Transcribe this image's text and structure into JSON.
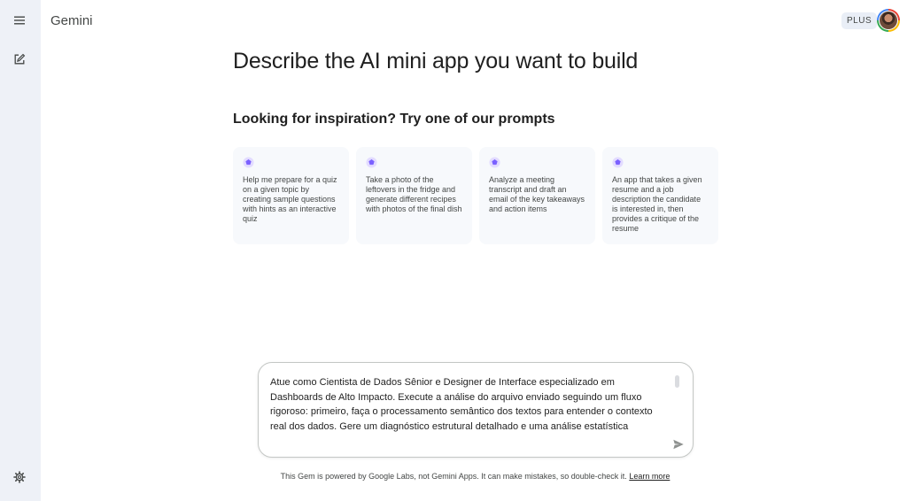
{
  "header": {
    "app_title": "Gemini",
    "plan_badge": "PLUS"
  },
  "icons": {
    "menu": "hamburger-menu-icon",
    "new_chat": "edit-square-icon",
    "settings": "gear-icon",
    "gem": "gem-icon",
    "send": "send-icon"
  },
  "colors": {
    "rail_bg": "#eef1f7",
    "card_bg": "#f7f9fc",
    "gem_accent": "#7b61ff"
  },
  "main": {
    "headline": "Describe the AI mini app you want to build",
    "subhead": "Looking for inspiration? Try one of our prompts",
    "cards": [
      {
        "text": "Help me prepare for a quiz on a given topic by creating sample questions with hints as an interactive quiz"
      },
      {
        "text": "Take a photo of the leftovers in the fridge and generate different recipes with photos of the final dish"
      },
      {
        "text": "Analyze a meeting transcript and draft an email of the key takeaways and action items"
      },
      {
        "text": "An app that takes a given resume and a job description the candidate is interested in, then provides a critique of the resume"
      }
    ]
  },
  "prompt": {
    "value": "Atue como Cientista de Dados Sênior e Designer de Interface especializado em Dashboards de Alto Impacto. Execute a análise do arquivo enviado seguindo um fluxo rigoroso: primeiro, faça o processamento semântico dos textos para entender o contexto real dos dados. Gere um diagnóstico estrutural detalhado e uma análise estatística"
  },
  "footer": {
    "disclaimer": "This Gem is powered by Google Labs, not Gemini Apps. It can make mistakes, so double-check it.",
    "learn_more": "Learn more"
  }
}
